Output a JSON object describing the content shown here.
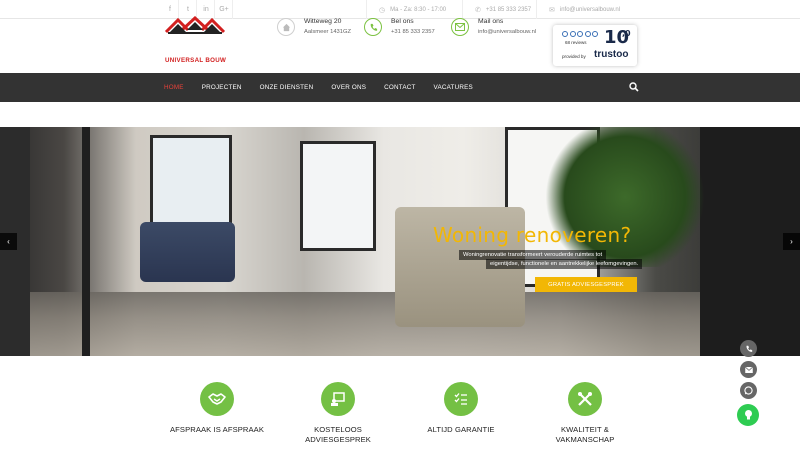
{
  "topbar": {
    "social": [
      "f",
      "t",
      "in",
      "G+"
    ],
    "hours": "Ma - Za: 8:30 - 17:00",
    "phone": "+31 85 333 2357",
    "email": "info@universalbouw.nl"
  },
  "header": {
    "logo_text": "UNIVERSAL BOUW",
    "address": {
      "line1": "Witteweg 20",
      "line2": "Aalsmeer 1431GZ"
    },
    "call": {
      "label": "Bel ons",
      "value": "+31 85 333 2357"
    },
    "mail": {
      "label": "Mail ons",
      "value": "info@universalbouw.nl"
    },
    "trustoo": {
      "score": "10",
      "score_decimal": ",0",
      "reviews": "68 reviews",
      "provided": "provided by",
      "brand": "trustoo"
    }
  },
  "nav": {
    "items": [
      "HOME",
      "PROJECTEN",
      "ONZE DIENSTEN",
      "OVER ONS",
      "CONTACT",
      "VACATURES"
    ],
    "active": "HOME"
  },
  "hero": {
    "headline": "Woning renoveren?",
    "sub1": "Woningrenovatie transformeert verouderde ruimtes tot",
    "sub2": "eigentijdse, functionele en aantrekkelijke leefomgevingen.",
    "cta": "GRATIS ADVIESGESPREK",
    "prev": "‹",
    "next": "›"
  },
  "features": [
    {
      "label": "AFSPRAAK IS AFSPRAAK",
      "icon": "handshake-icon"
    },
    {
      "label": "KOSTELOOS ADVIESGESPREK",
      "icon": "consultation-icon"
    },
    {
      "label": "ALTIJD GARANTIE",
      "icon": "checklist-icon"
    },
    {
      "label": "KWALITEIT & VAKMANSCHAP",
      "icon": "tools-icon"
    }
  ],
  "colors": {
    "green": "#74c044",
    "accent": "#f2b705",
    "nav": "#333333",
    "active": "#e8423a"
  }
}
